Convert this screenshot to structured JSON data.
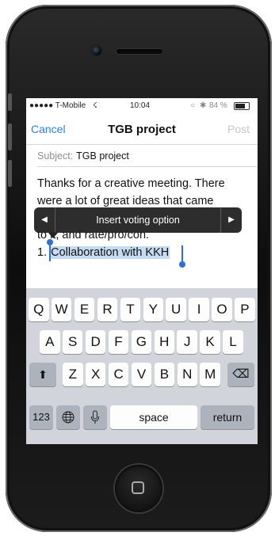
{
  "status_bar": {
    "carrier": "●●●●● T-Mobile",
    "wifi_icon": "☇",
    "time": "10:04",
    "battery_text": "84 %",
    "battery_level": 0.84
  },
  "nav": {
    "cancel": "Cancel",
    "title": "TGB project",
    "post": "Post"
  },
  "subject": {
    "label": "Subject:",
    "value": "TGB project"
  },
  "body": {
    "line1": "Thanks for a creative meeting. There",
    "line2": "were a lot of great ideas that came",
    "line3": "to it, and rate/pro/con.",
    "line4_prefix": "1. ",
    "line4_selected": "Collaboration with KKH"
  },
  "popup": {
    "left_arrow": "◀",
    "label": "Insert voting option",
    "right_arrow": "▶"
  },
  "keyboard": {
    "row1": [
      "Q",
      "W",
      "E",
      "R",
      "T",
      "Y",
      "U",
      "I",
      "O",
      "P"
    ],
    "row2": [
      "A",
      "S",
      "D",
      "F",
      "G",
      "H",
      "J",
      "K",
      "L"
    ],
    "row3": [
      "Z",
      "X",
      "C",
      "V",
      "B",
      "N",
      "M"
    ],
    "shift": "⬆",
    "backspace": "⌫",
    "numbers": "123",
    "globe": "◎",
    "mic": "🎙",
    "space": "space",
    "return": "return"
  },
  "colors": {
    "accent": "#2f7fe8",
    "selection": "#c5daf3",
    "keyboard_bg": "#d1d5db"
  }
}
